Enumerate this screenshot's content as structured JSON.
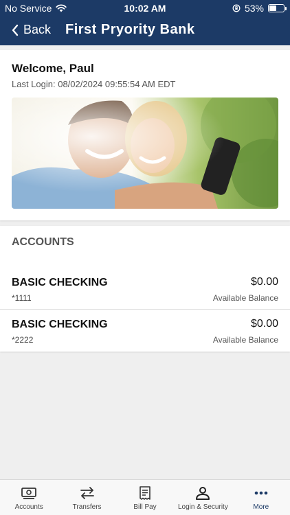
{
  "status_bar": {
    "carrier": "No Service",
    "time": "10:02 AM",
    "battery": "53%",
    "battery_level": 0.53
  },
  "header": {
    "back_label": "Back",
    "title": "First Pryority Bank"
  },
  "welcome": {
    "title": "Welcome, Paul",
    "last_login": "Last Login: 08/02/2024 09:55:54 AM EDT"
  },
  "accounts": {
    "heading": "ACCOUNTS",
    "items": [
      {
        "name": "BASIC CHECKING",
        "number": "*1111",
        "balance": "$0.00",
        "balance_label": "Available Balance"
      },
      {
        "name": "BASIC CHECKING",
        "number": "*2222",
        "balance": "$0.00",
        "balance_label": "Available Balance"
      }
    ]
  },
  "bottom_nav": {
    "items": [
      {
        "label": "Accounts",
        "icon": "accounts-icon"
      },
      {
        "label": "Transfers",
        "icon": "transfers-icon"
      },
      {
        "label": "Bill Pay",
        "icon": "bill-pay-icon"
      },
      {
        "label": "Login & Security",
        "icon": "person-icon"
      },
      {
        "label": "More",
        "icon": "more-icon"
      }
    ],
    "active": "More"
  },
  "colors": {
    "brand_navy": "#1c3a66",
    "background": "#efefef"
  }
}
